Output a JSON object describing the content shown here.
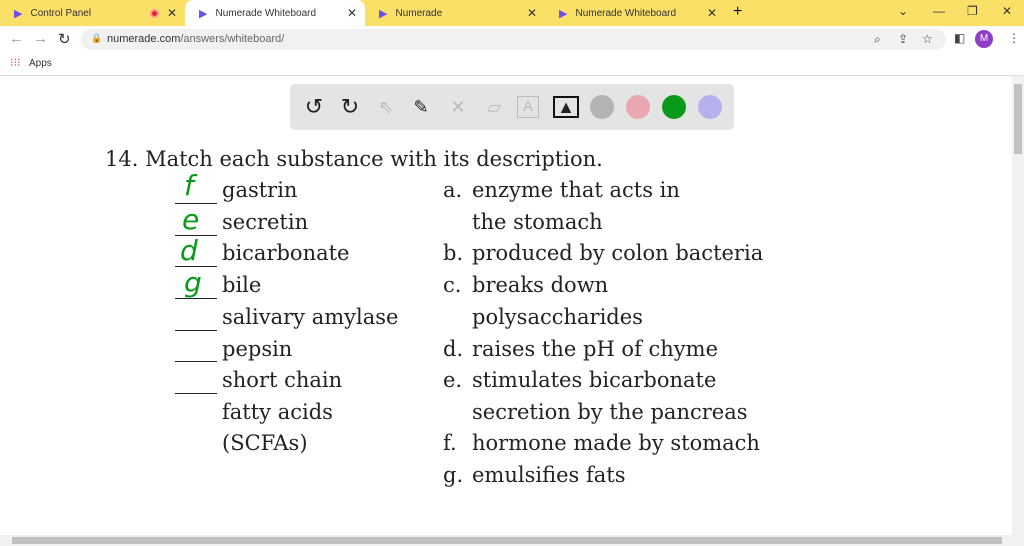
{
  "tabs": [
    {
      "title": "Control Panel",
      "recording": true
    },
    {
      "title": "Numerade Whiteboard",
      "active": true
    },
    {
      "title": "Numerade"
    },
    {
      "title": "Numerade Whiteboard"
    }
  ],
  "address": {
    "host": "numerade.com",
    "path": "/answers/whiteboard/",
    "avatar": "M"
  },
  "bookmarks": {
    "apps": "Apps"
  },
  "toolbar": {
    "colors": [
      "#b3b3b3",
      "#eaa7b1",
      "#0a9a1a",
      "#b5b1ec"
    ]
  },
  "question": {
    "title": "14.  Match each substance with its description.",
    "left": [
      "gastrin",
      "secretin",
      "bicarbonate",
      "bile",
      "salivary amylase",
      "pepsin",
      "short chain",
      "fatty acids",
      "(SCFAs)"
    ],
    "answers": [
      "f",
      "e",
      "d",
      "g"
    ],
    "right": [
      {
        "letter": "a.",
        "text": "enzyme that acts in"
      },
      {
        "letter": "",
        "text": "the stomach"
      },
      {
        "letter": "b.",
        "text": "produced by colon bacteria"
      },
      {
        "letter": "c.",
        "text": "breaks down"
      },
      {
        "letter": "",
        "text": " polysaccharides"
      },
      {
        "letter": "d.",
        "text": "raises the pH of chyme"
      },
      {
        "letter": "e.",
        "text": "stimulates bicarbonate"
      },
      {
        "letter": "",
        "text": "secretion by the pancreas"
      },
      {
        "letter": "f.",
        "text": "hormone made by stomach"
      },
      {
        "letter": "g.",
        "text": "emulsifies fats"
      }
    ]
  }
}
